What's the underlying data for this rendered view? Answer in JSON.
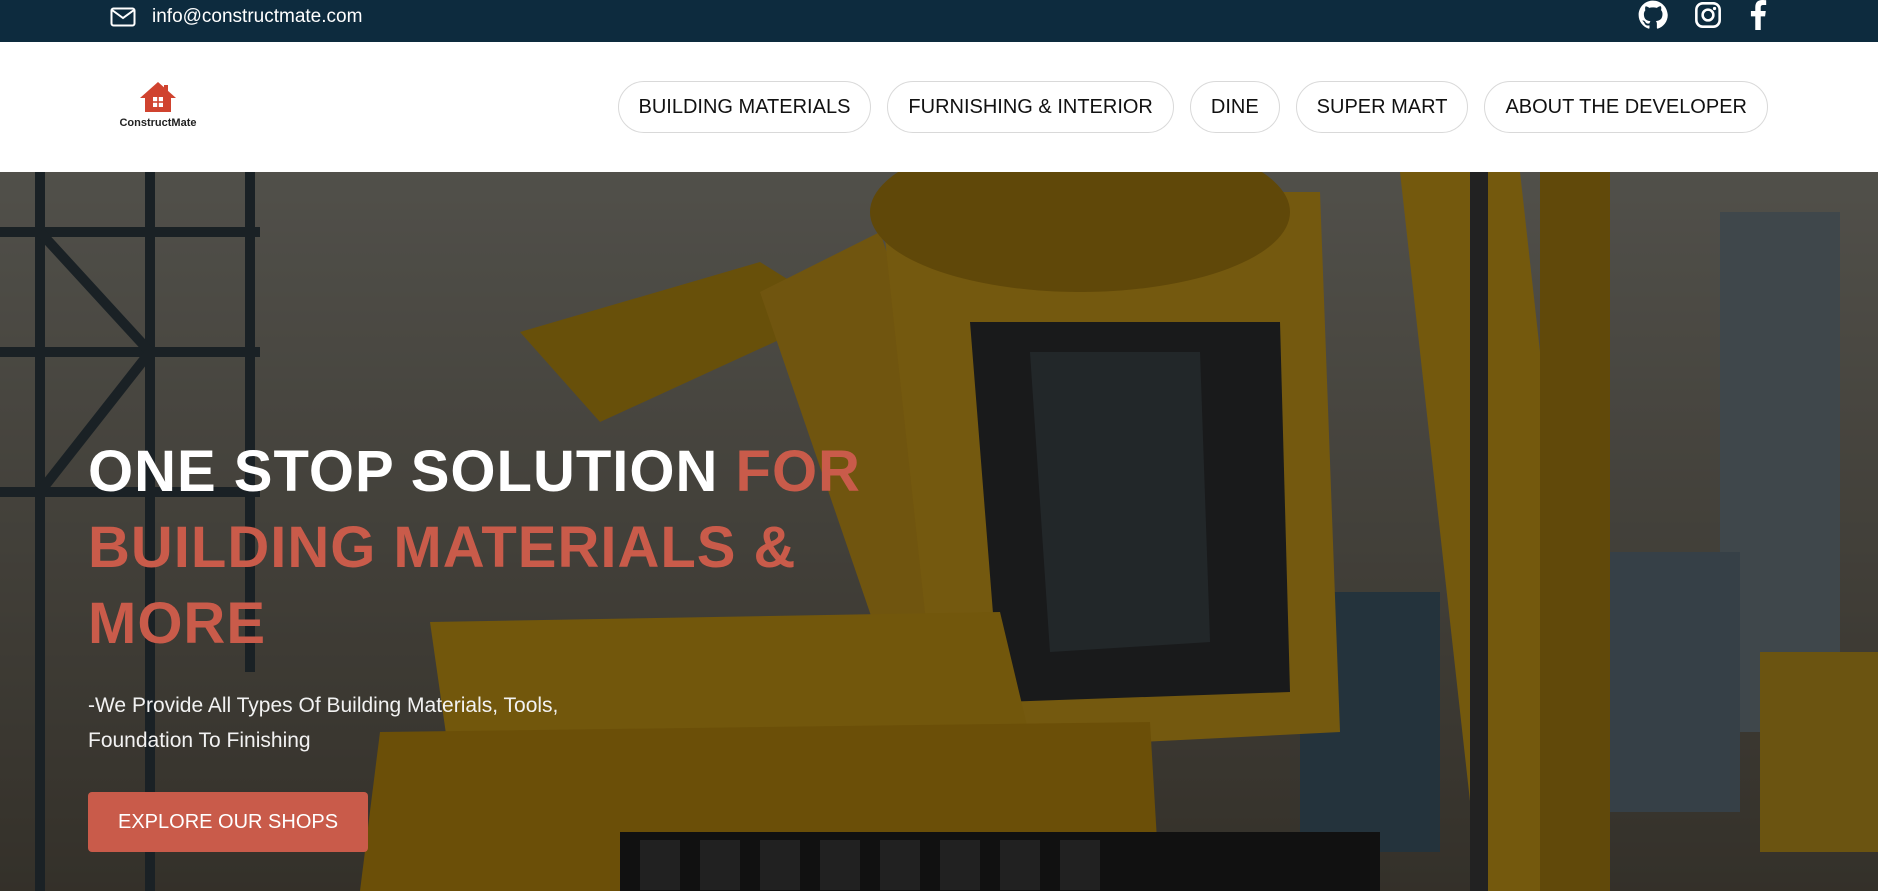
{
  "topbar": {
    "email": "info@constructmate.com",
    "icons": [
      "mail-icon",
      "github-icon",
      "instagram-icon",
      "facebook-icon"
    ]
  },
  "brand": {
    "name": "ConstructMate",
    "accent_color": "#c95b4a",
    "topbar_color": "#0d2b3e"
  },
  "nav": {
    "items": [
      {
        "label": "BUILDING MATERIALS"
      },
      {
        "label": "FURNISHING & INTERIOR"
      },
      {
        "label": "DINE"
      },
      {
        "label": "SUPER MART"
      },
      {
        "label": "ABOUT THE DEVELOPER"
      }
    ]
  },
  "hero": {
    "title_white": "ONE STOP SOLUTION",
    "title_accent": "FOR BUILDING MATERIALS & MORE",
    "subtitle": "-We Provide All Types Of Building Materials, Tools, Foundation To Finishing",
    "cta_label": "EXPLORE OUR SHOPS"
  }
}
